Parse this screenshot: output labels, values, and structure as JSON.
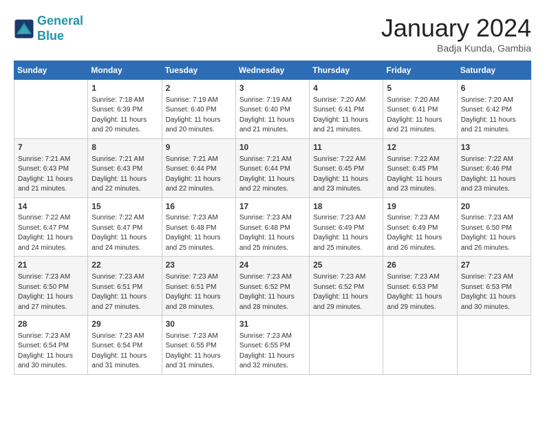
{
  "logo": {
    "line1": "General",
    "line2": "Blue"
  },
  "title": "January 2024",
  "subtitle": "Badja Kunda, Gambia",
  "days_header": [
    "Sunday",
    "Monday",
    "Tuesday",
    "Wednesday",
    "Thursday",
    "Friday",
    "Saturday"
  ],
  "weeks": [
    [
      {
        "day": "",
        "info": ""
      },
      {
        "day": "1",
        "info": "Sunrise: 7:18 AM\nSunset: 6:39 PM\nDaylight: 11 hours\nand 20 minutes."
      },
      {
        "day": "2",
        "info": "Sunrise: 7:19 AM\nSunset: 6:40 PM\nDaylight: 11 hours\nand 20 minutes."
      },
      {
        "day": "3",
        "info": "Sunrise: 7:19 AM\nSunset: 6:40 PM\nDaylight: 11 hours\nand 21 minutes."
      },
      {
        "day": "4",
        "info": "Sunrise: 7:20 AM\nSunset: 6:41 PM\nDaylight: 11 hours\nand 21 minutes."
      },
      {
        "day": "5",
        "info": "Sunrise: 7:20 AM\nSunset: 6:41 PM\nDaylight: 11 hours\nand 21 minutes."
      },
      {
        "day": "6",
        "info": "Sunrise: 7:20 AM\nSunset: 6:42 PM\nDaylight: 11 hours\nand 21 minutes."
      }
    ],
    [
      {
        "day": "7",
        "info": "Sunrise: 7:21 AM\nSunset: 6:43 PM\nDaylight: 11 hours\nand 21 minutes."
      },
      {
        "day": "8",
        "info": "Sunrise: 7:21 AM\nSunset: 6:43 PM\nDaylight: 11 hours\nand 22 minutes."
      },
      {
        "day": "9",
        "info": "Sunrise: 7:21 AM\nSunset: 6:44 PM\nDaylight: 11 hours\nand 22 minutes."
      },
      {
        "day": "10",
        "info": "Sunrise: 7:21 AM\nSunset: 6:44 PM\nDaylight: 11 hours\nand 22 minutes."
      },
      {
        "day": "11",
        "info": "Sunrise: 7:22 AM\nSunset: 6:45 PM\nDaylight: 11 hours\nand 23 minutes."
      },
      {
        "day": "12",
        "info": "Sunrise: 7:22 AM\nSunset: 6:45 PM\nDaylight: 11 hours\nand 23 minutes."
      },
      {
        "day": "13",
        "info": "Sunrise: 7:22 AM\nSunset: 6:46 PM\nDaylight: 11 hours\nand 23 minutes."
      }
    ],
    [
      {
        "day": "14",
        "info": "Sunrise: 7:22 AM\nSunset: 6:47 PM\nDaylight: 11 hours\nand 24 minutes."
      },
      {
        "day": "15",
        "info": "Sunrise: 7:22 AM\nSunset: 6:47 PM\nDaylight: 11 hours\nand 24 minutes."
      },
      {
        "day": "16",
        "info": "Sunrise: 7:23 AM\nSunset: 6:48 PM\nDaylight: 11 hours\nand 25 minutes."
      },
      {
        "day": "17",
        "info": "Sunrise: 7:23 AM\nSunset: 6:48 PM\nDaylight: 11 hours\nand 25 minutes."
      },
      {
        "day": "18",
        "info": "Sunrise: 7:23 AM\nSunset: 6:49 PM\nDaylight: 11 hours\nand 25 minutes."
      },
      {
        "day": "19",
        "info": "Sunrise: 7:23 AM\nSunset: 6:49 PM\nDaylight: 11 hours\nand 26 minutes."
      },
      {
        "day": "20",
        "info": "Sunrise: 7:23 AM\nSunset: 6:50 PM\nDaylight: 11 hours\nand 26 minutes."
      }
    ],
    [
      {
        "day": "21",
        "info": "Sunrise: 7:23 AM\nSunset: 6:50 PM\nDaylight: 11 hours\nand 27 minutes."
      },
      {
        "day": "22",
        "info": "Sunrise: 7:23 AM\nSunset: 6:51 PM\nDaylight: 11 hours\nand 27 minutes."
      },
      {
        "day": "23",
        "info": "Sunrise: 7:23 AM\nSunset: 6:51 PM\nDaylight: 11 hours\nand 28 minutes."
      },
      {
        "day": "24",
        "info": "Sunrise: 7:23 AM\nSunset: 6:52 PM\nDaylight: 11 hours\nand 28 minutes."
      },
      {
        "day": "25",
        "info": "Sunrise: 7:23 AM\nSunset: 6:52 PM\nDaylight: 11 hours\nand 29 minutes."
      },
      {
        "day": "26",
        "info": "Sunrise: 7:23 AM\nSunset: 6:53 PM\nDaylight: 11 hours\nand 29 minutes."
      },
      {
        "day": "27",
        "info": "Sunrise: 7:23 AM\nSunset: 6:53 PM\nDaylight: 11 hours\nand 30 minutes."
      }
    ],
    [
      {
        "day": "28",
        "info": "Sunrise: 7:23 AM\nSunset: 6:54 PM\nDaylight: 11 hours\nand 30 minutes."
      },
      {
        "day": "29",
        "info": "Sunrise: 7:23 AM\nSunset: 6:54 PM\nDaylight: 11 hours\nand 31 minutes."
      },
      {
        "day": "30",
        "info": "Sunrise: 7:23 AM\nSunset: 6:55 PM\nDaylight: 11 hours\nand 31 minutes."
      },
      {
        "day": "31",
        "info": "Sunrise: 7:23 AM\nSunset: 6:55 PM\nDaylight: 11 hours\nand 32 minutes."
      },
      {
        "day": "",
        "info": ""
      },
      {
        "day": "",
        "info": ""
      },
      {
        "day": "",
        "info": ""
      }
    ]
  ]
}
